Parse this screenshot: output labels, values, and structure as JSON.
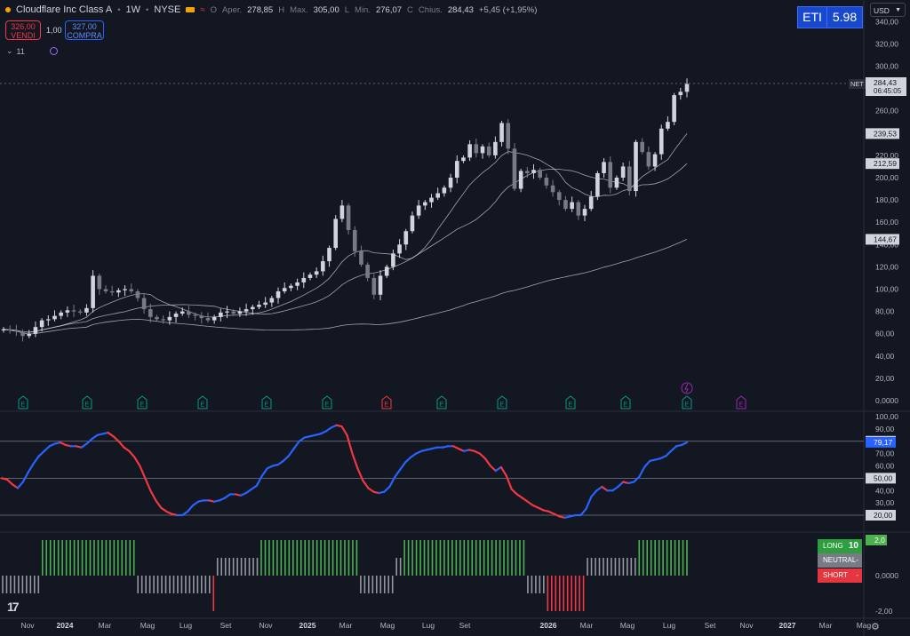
{
  "header": {
    "symbol": "Cloudflare Inc Class A",
    "interval": "1W",
    "exchange": "NYSE",
    "sep": "•",
    "open_label": "O",
    "open_word": "Aper.",
    "open_value": "278,85",
    "high_label": "H",
    "high_word": "Max.",
    "high_value": "305,00",
    "low_label": "L",
    "low_word": "Min.",
    "low_value": "276,07",
    "close_label": "C",
    "close_word": "Chius.",
    "close_value": "284,43",
    "change": "+5,45 (+1,95%)"
  },
  "trade": {
    "sell_price": "326,00",
    "sell_label": "VENDI",
    "spread": "1,00",
    "buy_price": "327,00",
    "buy_label": "COMPRA"
  },
  "indicators_collapse": {
    "chevron": "⌄",
    "count": "11"
  },
  "eti": {
    "label": "ETI",
    "value": "5.98"
  },
  "currency": "USD",
  "signal_panel": {
    "long_label": "LONG",
    "long_value": "10",
    "neutral_label": "NEUTRAL",
    "neutral_value": "-",
    "short_label": "SHORT",
    "short_value": "-"
  },
  "colors": {
    "background": "#131722",
    "grid": "#1e222d",
    "bull_candle": "#d1d4dc",
    "bear_candle": "#787b86",
    "oscillator_up": "#2962ff",
    "oscillator_down": "#f23645",
    "signal_long": "#4caf50",
    "signal_neutral": "#9598a1",
    "signal_short": "#f23645",
    "earnings": "#089981",
    "earnings_negative": "#f23645",
    "dividend": "#9c27b0"
  },
  "chart_data": [
    {
      "type": "candlestick",
      "symbol": "NET",
      "x_axis_labels": [
        "Nov",
        "2024",
        "Mar",
        "Mag",
        "Lug",
        "Set",
        "Nov",
        "2025",
        "Mar",
        "Mag",
        "Lug",
        "Set",
        "2026",
        "Mar",
        "Mag",
        "Lug",
        "Set",
        "Nov",
        "2027",
        "Mar",
        "Mag"
      ],
      "y_axis_labels": [
        "340,00",
        "320,00",
        "300,00",
        "280,00",
        "260,00",
        "240,00",
        "220,00",
        "200,00",
        "180,00",
        "160,00",
        "140,00",
        "120,00",
        "100,00",
        "80,00",
        "60,00",
        "40,00",
        "20,00",
        "0,0000"
      ],
      "ylim": [
        0,
        345
      ],
      "last_price": 284.43,
      "last_price_label": "284,43",
      "last_price_symbol": "NET",
      "countdown": "06:45:05",
      "moving_average_labels": [
        "239,53",
        "212,59",
        "144,67"
      ],
      "moving_averages": [
        {
          "last_value": 239.53
        },
        {
          "last_value": 212.59
        },
        {
          "last_value": 144.67
        }
      ],
      "closes": [
        64,
        63,
        62,
        58,
        60,
        66,
        72,
        73,
        76,
        79,
        81,
        80,
        79,
        83,
        112,
        100,
        98,
        97,
        99,
        100,
        98,
        92,
        82,
        75,
        73,
        72,
        75,
        78,
        80,
        77,
        76,
        74,
        72,
        75,
        79,
        80,
        78,
        80,
        82,
        84,
        86,
        88,
        92,
        98,
        101,
        103,
        106,
        110,
        113,
        116,
        125,
        137,
        163,
        175,
        153,
        134,
        122,
        110,
        95,
        112,
        120,
        132,
        140,
        152,
        166,
        175,
        178,
        182,
        186,
        191,
        200,
        215,
        218,
        230,
        222,
        228,
        220,
        232,
        249,
        226,
        190,
        206,
        204,
        207,
        200,
        193,
        187,
        180,
        172,
        178,
        166,
        172,
        183,
        204,
        214,
        191,
        200,
        210,
        188,
        232,
        223,
        210,
        221,
        244,
        250,
        274,
        277,
        284
      ],
      "earnings_markers": [
        {
          "label": "E",
          "negative": false
        },
        {
          "label": "E",
          "negative": false
        },
        {
          "label": "E",
          "negative": false
        },
        {
          "label": "E",
          "negative": false
        },
        {
          "label": "E",
          "negative": false
        },
        {
          "label": "E",
          "negative": false
        },
        {
          "label": "E",
          "negative": true
        },
        {
          "label": "E",
          "negative": false
        },
        {
          "label": "E",
          "negative": false
        },
        {
          "label": "E",
          "negative": false
        },
        {
          "label": "E",
          "negative": false
        },
        {
          "label": "E",
          "negative": false
        },
        {
          "label": "E",
          "negative": false,
          "future": true
        }
      ],
      "event_icon": "lightning-icon"
    },
    {
      "type": "line",
      "name": "oscillator",
      "y_axis_labels": [
        "100,00",
        "90,00",
        "80,00",
        "70,00",
        "60,00",
        "50,00",
        "40,00",
        "30,00",
        "20,00"
      ],
      "levels": [
        80,
        50,
        20
      ],
      "level_labels": [
        "80,00",
        "50,00",
        "20,00"
      ],
      "last_value": 79.17,
      "last_value_label": "79,17",
      "ylim": [
        10,
        100
      ],
      "values": [
        50,
        49,
        45,
        42,
        47,
        55,
        62,
        68,
        72,
        76,
        78,
        79,
        77,
        76,
        76,
        75,
        78,
        82,
        85,
        86,
        87,
        84,
        80,
        75,
        72,
        67,
        60,
        50,
        40,
        32,
        26,
        23,
        21,
        20,
        20,
        23,
        28,
        31,
        32,
        32,
        31,
        32,
        34,
        37,
        37,
        36,
        38,
        41,
        44,
        52,
        58,
        60,
        61,
        64,
        68,
        74,
        80,
        83,
        84,
        85,
        86,
        88,
        91,
        93,
        92,
        85,
        70,
        58,
        48,
        42,
        39,
        38,
        39,
        43,
        51,
        57,
        63,
        67,
        70,
        72,
        73,
        74,
        75,
        75,
        76,
        76,
        74,
        72,
        73,
        72,
        70,
        66,
        60,
        56,
        59,
        52,
        41,
        37,
        34,
        31,
        28,
        26,
        24,
        23,
        21,
        19,
        18,
        19,
        20,
        20,
        25,
        35,
        40,
        43,
        40,
        40,
        43,
        47,
        46,
        47,
        51,
        59,
        64,
        65,
        66,
        68,
        72,
        76,
        77,
        79
      ]
    },
    {
      "type": "bar",
      "name": "signal",
      "y_axis_labels": [
        "2,0",
        "0,0000",
        "-2,00"
      ],
      "ylim": [
        -2.2,
        2.2
      ],
      "values": [
        0,
        0,
        0,
        0,
        0,
        0,
        0,
        0,
        0,
        0,
        1,
        1,
        1,
        1,
        1,
        1,
        1,
        1,
        1,
        1,
        1,
        1,
        1,
        1,
        1,
        1,
        1,
        1,
        1,
        1,
        1,
        1,
        1,
        1,
        0,
        0,
        0,
        0,
        0,
        0,
        0,
        0,
        0,
        0,
        0,
        0,
        0,
        0,
        0,
        0,
        0,
        0,
        0,
        -1,
        0.5,
        0.5,
        0.5,
        0.5,
        0.5,
        0.5,
        0.5,
        0.5,
        0.5,
        0.5,
        0.5,
        1,
        1,
        1,
        1,
        1,
        1,
        1,
        1,
        1,
        1,
        1,
        1,
        1,
        1,
        1,
        1,
        1,
        1,
        1,
        1,
        1,
        1,
        1,
        1,
        1,
        0,
        0,
        0,
        0,
        0,
        0,
        0,
        0,
        0,
        0.5,
        0.5,
        1,
        1,
        1,
        1,
        1,
        1,
        1,
        1,
        1,
        1,
        1,
        1,
        1,
        1,
        1,
        1,
        1,
        1,
        1,
        1,
        1,
        1,
        1,
        1,
        1,
        1,
        1,
        1,
        1,
        1,
        1,
        0,
        0,
        0,
        0,
        0,
        -1,
        -1,
        -1,
        -1,
        -1,
        -1,
        -1,
        -1,
        -1,
        -1,
        0.5,
        0.5,
        0.5,
        0.5,
        0.5,
        0.5,
        0.5,
        0.5,
        0.5,
        0.5,
        0.5,
        0.5,
        0.5,
        1,
        1,
        1,
        1,
        1,
        1,
        1,
        1,
        1,
        1,
        1,
        1,
        1
      ]
    }
  ]
}
